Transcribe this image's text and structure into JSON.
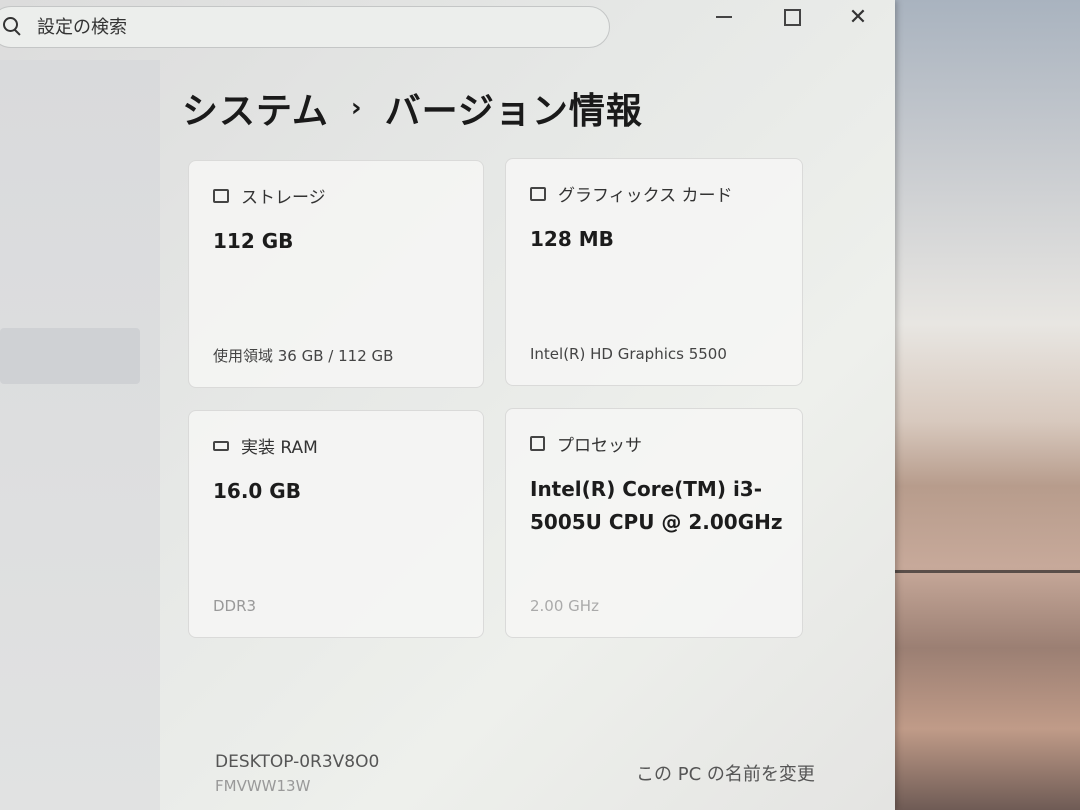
{
  "search": {
    "placeholder": "設定の検索"
  },
  "window_controls": {
    "close": "✕"
  },
  "breadcrumb": {
    "parent": "システム",
    "separator": "›",
    "current": "バージョン情報"
  },
  "cards": {
    "storage": {
      "title": "ストレージ",
      "value": "112 GB",
      "sub": "使用領域 36 GB / 112 GB",
      "icon": "storage-icon"
    },
    "graphics": {
      "title": "グラフィックス カード",
      "value": "128 MB",
      "sub": "Intel(R) HD Graphics 5500",
      "icon": "graphics-card-icon"
    },
    "ram": {
      "title": "実装 RAM",
      "value": "16.0 GB",
      "sub": "DDR3",
      "icon": "ram-icon"
    },
    "processor": {
      "title": "プロセッサ",
      "value": "Intel(R) Core(TM) i3-5005U CPU @ 2.00GHz",
      "sub": "2.00 GHz",
      "icon": "processor-icon"
    }
  },
  "device": {
    "name": "DESKTOP-0R3V8O0",
    "model": "FMVWW13W"
  },
  "rename_link": "この PC の名前を変更"
}
